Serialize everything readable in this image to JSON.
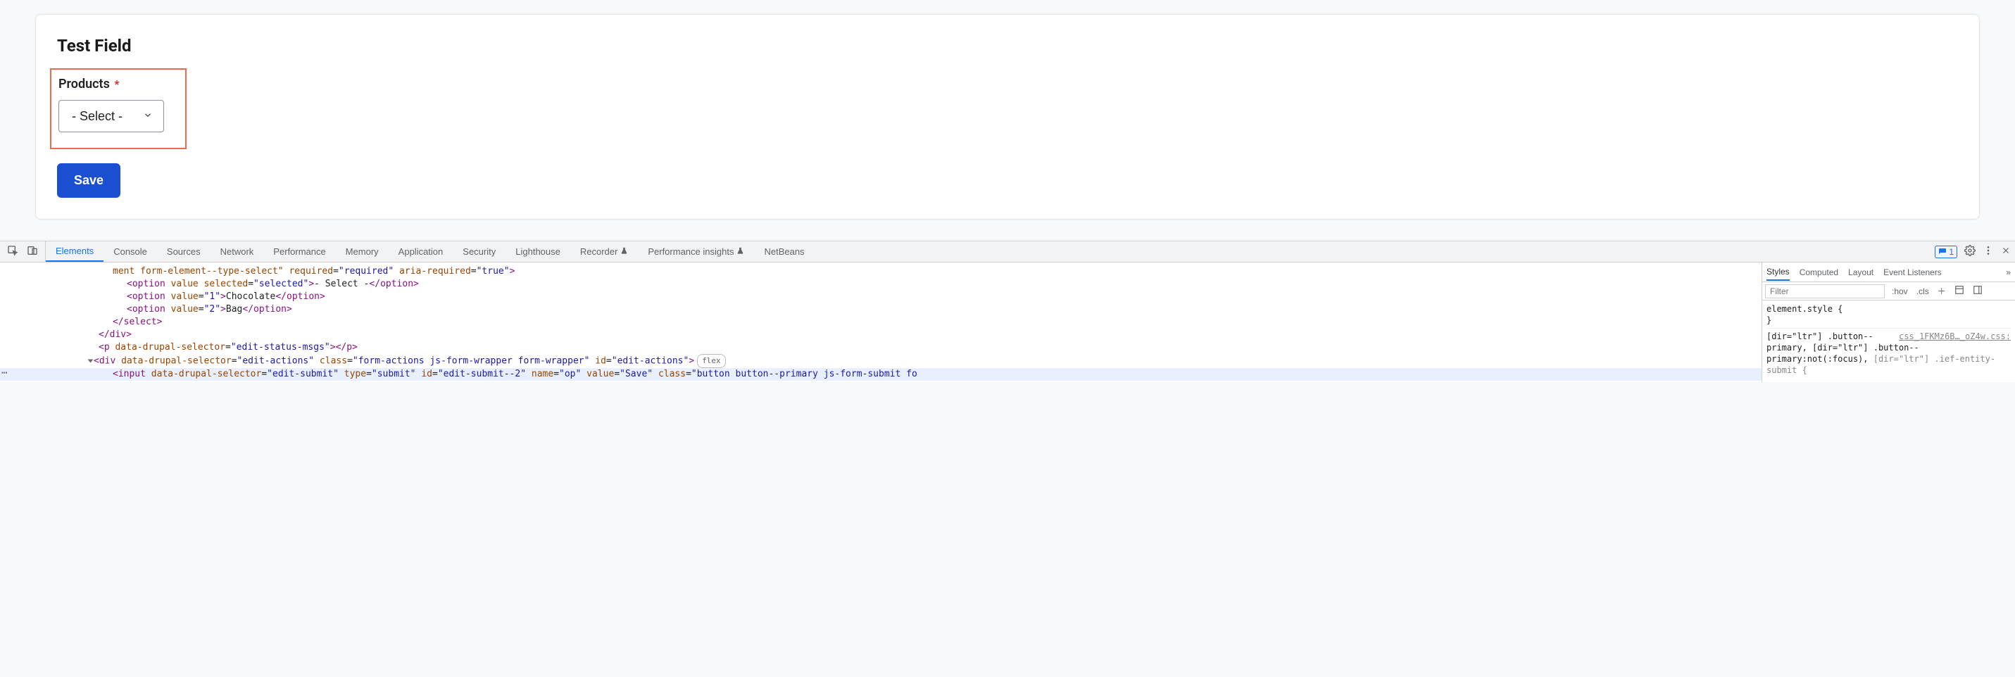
{
  "form": {
    "title": "Test Field",
    "products_label": "Products",
    "select_value": "- Select -",
    "options": [
      "- Select -",
      "Chocolate",
      "Bag"
    ],
    "save_label": "Save"
  },
  "devtools": {
    "tabs": {
      "elements": "Elements",
      "console": "Console",
      "sources": "Sources",
      "network": "Network",
      "performance": "Performance",
      "memory": "Memory",
      "application": "Application",
      "security": "Security",
      "lighthouse": "Lighthouse",
      "recorder": "Recorder",
      "perf_insights": "Performance insights",
      "netbeans": "NetBeans"
    },
    "issues_count": "1",
    "elements_panel": {
      "line0_frag": "ment form-element--type-select\" required=\"required\" aria-required=\"true\">",
      "opt_sel_tag_open": "<option value selected=\"selected\">",
      "opt_sel_text": "- Select -",
      "opt1_tag_open": "<option value=\"1\">",
      "opt1_text": "Chocolate",
      "opt2_tag_open": "<option value=\"2\">",
      "opt2_text": "Bag",
      "close_option": "</option>",
      "close_select": "</select>",
      "close_div": "</div>",
      "p_line": "<p data-drupal-selector=\"edit-status-msgs\"></p>",
      "actions_open": "<div data-drupal-selector=\"edit-actions\" class=\"form-actions js-form-wrapper form-wrapper\" id=\"edit-actions\">",
      "flex_pill": "flex",
      "input_line": "<input data-drupal-selector=\"edit-submit\" type=\"submit\" id=\"edit-submit--2\" name=\"op\" value=\"Save\" class=\"button button--primary js-form-submit fo"
    },
    "styles_panel": {
      "tabs": {
        "styles": "Styles",
        "computed": "Computed",
        "layout": "Layout",
        "event_listeners": "Event Listeners"
      },
      "filter_placeholder": "Filter",
      "hov": ":hov",
      "cls": ".cls",
      "element_style": "element.style {",
      "brace_close": "}",
      "rule1_selector": "[dir=\"ltr\"] .button--primary, [dir=\"ltr\"] .button--primary:not(:focus),",
      "rule1_source": "css_1FKMz6B…_oZ4w.css:",
      "rule1_tail": "[dir=\"ltr\"] .ief-entity-submit {"
    }
  }
}
